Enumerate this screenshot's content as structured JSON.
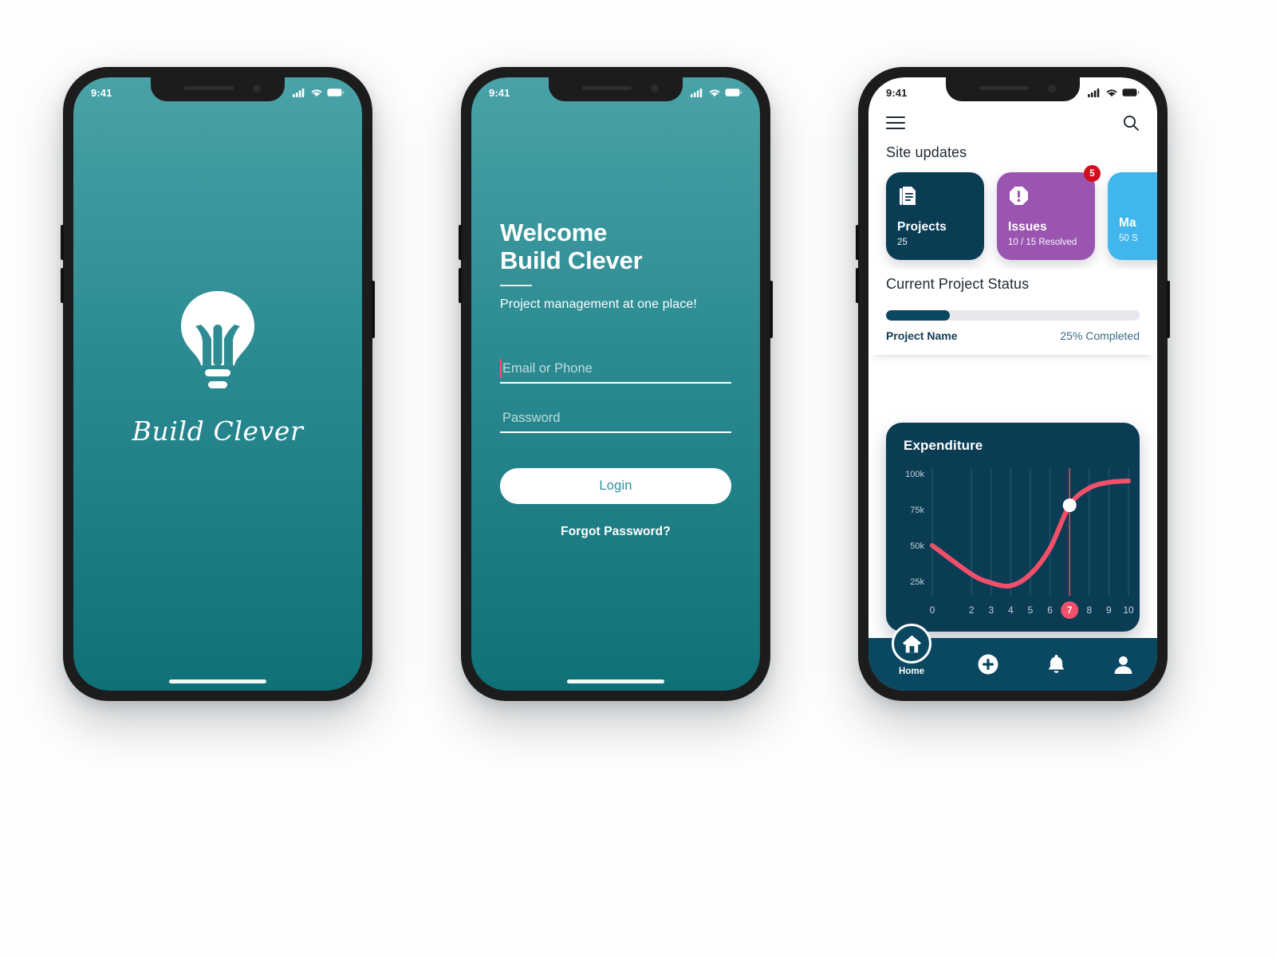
{
  "phones": {
    "status_bar": {
      "time": "9:41",
      "icons": [
        "signal-icon",
        "wifi-icon",
        "battery-icon"
      ]
    }
  },
  "splash": {
    "logo_icon": "lightbulb-icon",
    "app_name": "Build Clever"
  },
  "login": {
    "heading_line1": "Welcome",
    "heading_line2": "Build Clever",
    "subtitle": "Project management at one place!",
    "fields": [
      {
        "name": "email-or-phone",
        "placeholder": "Email or Phone",
        "value": "",
        "focused": true
      },
      {
        "name": "password",
        "placeholder": "Password",
        "value": "",
        "focused": false
      }
    ],
    "login_label": "Login",
    "forgot_label": "Forgot Password?"
  },
  "dashboard": {
    "appbar": {
      "menu_icon": "hamburger-menu-icon",
      "search_icon": "search-icon"
    },
    "site_updates_title": "Site updates",
    "cards": [
      {
        "title": "Projects",
        "subtitle": "25",
        "icon": "document-list-icon",
        "color": "#0a3c54",
        "badge": null
      },
      {
        "title": "Issues",
        "subtitle": "10 / 15 Resolved",
        "icon": "alert-octagon-icon",
        "color": "#9a55b0",
        "badge": "5"
      },
      {
        "title": "Ma",
        "subtitle": "50 S",
        "icon": "",
        "color": "#41b6ec",
        "badge": null
      }
    ],
    "project_status_title": "Current Project Status",
    "progress": {
      "name": "Project Name",
      "percent_label": "25% Completed",
      "percent": 25,
      "fill_color": "#0a4760",
      "track_color": "#e9e7ee"
    },
    "bottom_nav": {
      "items": [
        {
          "name": "home",
          "label": "Home",
          "icon": "home-icon",
          "active": true
        },
        {
          "name": "add",
          "label": "",
          "icon": "plus-circle-icon",
          "active": false
        },
        {
          "name": "notifications",
          "label": "",
          "icon": "bell-icon",
          "active": false
        },
        {
          "name": "profile",
          "label": "",
          "icon": "person-icon",
          "active": false
        }
      ]
    }
  },
  "chart_data": {
    "type": "line",
    "title": "Expenditure",
    "xlabel": "",
    "ylabel": "",
    "x": [
      0,
      2,
      3,
      4,
      5,
      6,
      7,
      8,
      9,
      10
    ],
    "xtick_labels": [
      "0",
      "2",
      "3",
      "4",
      "5",
      "6",
      "7",
      "8",
      "9",
      "10"
    ],
    "ytick_labels": [
      "25k",
      "50k",
      "75k",
      "100k"
    ],
    "ytick_values": [
      25000,
      50000,
      75000,
      100000
    ],
    "ylim": [
      15000,
      105000
    ],
    "xlim": [
      0,
      10
    ],
    "series": [
      {
        "name": "Expenditure",
        "color": "#f2506a",
        "values": [
          50000,
          30000,
          24000,
          22000,
          30000,
          48000,
          78000,
          90000,
          94000,
          95000
        ]
      }
    ],
    "highlight": {
      "x": 7,
      "y": 78000,
      "marker_color": "#ffffff",
      "tick_pill_color": "#f2506a",
      "tick_label": "7",
      "vline_color": "#f2506a"
    },
    "grid": {
      "vertical": true,
      "horizontal": false,
      "color": "#2b5c74"
    },
    "background": "#0a3c54",
    "legend": false
  }
}
